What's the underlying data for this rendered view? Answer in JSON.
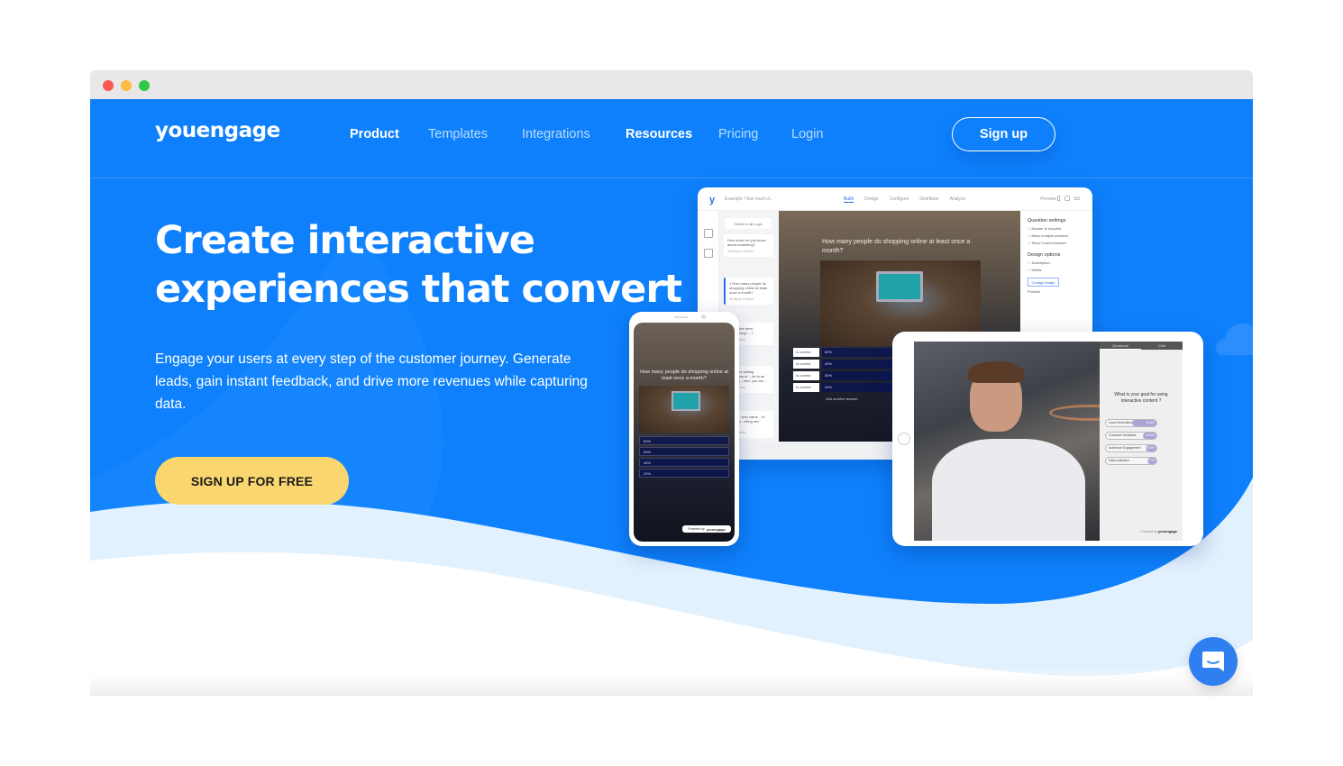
{
  "window": {
    "controls": [
      "close",
      "minimize",
      "maximize"
    ]
  },
  "nav": {
    "logo": "youengage",
    "links": [
      {
        "label": "Product",
        "emphasis": true
      },
      {
        "label": "Templates",
        "emphasis": false
      },
      {
        "label": "Integrations",
        "emphasis": false
      },
      {
        "label": "Resources",
        "emphasis": true
      },
      {
        "label": "Pricing",
        "emphasis": false
      },
      {
        "label": "Login",
        "emphasis": false
      }
    ],
    "signup_label": "Sign up"
  },
  "hero": {
    "headline_line1": "Create interactive",
    "headline_line2": "experiences that convert",
    "subtext": "Engage your users at every step of the customer journey. Generate leads, gain instant feedback, and drive more revenues while capturing data.",
    "cta_label": "SIGN UP FOR FREE"
  },
  "laptop_mockup": {
    "logo": "y",
    "example_field": "Example: How much d...",
    "steps": [
      "Build",
      "Design",
      "Configure",
      "Distribute",
      "Analyze"
    ],
    "active_step": "Build",
    "preview_label": "Preview",
    "switch_label": "Switch to ⇄ Logic",
    "question_cards": [
      {
        "text": "How much do you know about marketing?",
        "meta": "Welcome screen"
      },
      {
        "text": "1 How many people do shopping online at least once a month?",
        "meta": "Multiple Choice"
      },
      {
        "text": "...does the term ...screening\" ...?",
        "meta": "...le Choice"
      },
      {
        "text": "...you are selling ...services or ...ds to an existing ...mer, you are...",
        "meta": "...le Choice"
      },
      {
        "text": "...erson, who came ...th the term ...eting mix\" was...",
        "meta": "...le Choice"
      }
    ],
    "question": "How many people do shopping online at least once a month?",
    "answers": [
      {
        "checked": true,
        "check_label": "Is correct",
        "value": "60%"
      },
      {
        "checked": false,
        "check_label": "Is correct",
        "value": "40%"
      },
      {
        "checked": false,
        "check_label": "Is correct",
        "value": "50%"
      },
      {
        "checked": false,
        "check_label": "Is correct",
        "value": "20%"
      }
    ],
    "add_answer_label": "Add another answer",
    "settings": {
      "question_settings_title": "Question settings",
      "question_options": [
        {
          "label": "Answer is required",
          "checked": true
        },
        {
          "label": "Allow multiple answers",
          "checked": false
        },
        {
          "label": "Show Correct Answer",
          "checked": true
        }
      ],
      "design_options_title": "Design options",
      "design_options": [
        {
          "label": "Description",
          "checked": false
        },
        {
          "label": "Media",
          "checked": true
        }
      ],
      "change_image_label": "Change image",
      "position_label": "Position"
    }
  },
  "phone_mockup": {
    "question": "How many people do shopping online at least once a month?",
    "answers": [
      "60%",
      "50%",
      "40%",
      "20%"
    ],
    "powered_by": "Powered by",
    "brand": "youengage"
  },
  "tablet_mockup": {
    "tabs": [
      "Questions",
      "Chat"
    ],
    "active_tab": "Questions",
    "question": "What is your goal for using interactive content ?",
    "options": [
      {
        "label": "Lead Generation",
        "value": "44.8%",
        "percent": 44.8
      },
      {
        "label": "Customer feedback",
        "value": "24.5%",
        "percent": 24.5
      },
      {
        "label": "Audience Engagement",
        "value": "20.0%",
        "percent": 20.0
      },
      {
        "label": "Data collection",
        "value": "5.7%",
        "percent": 5.7
      }
    ],
    "powered_by": "Powered by",
    "brand": "youengage"
  },
  "chat_widget": {
    "icon": "chat-bubble-smile-icon"
  },
  "colors": {
    "brand_blue": "#0e80fc",
    "cta_yellow": "#fad66e",
    "chat_blue": "#2e7ff0",
    "wave_light": "#e2f1fe"
  }
}
